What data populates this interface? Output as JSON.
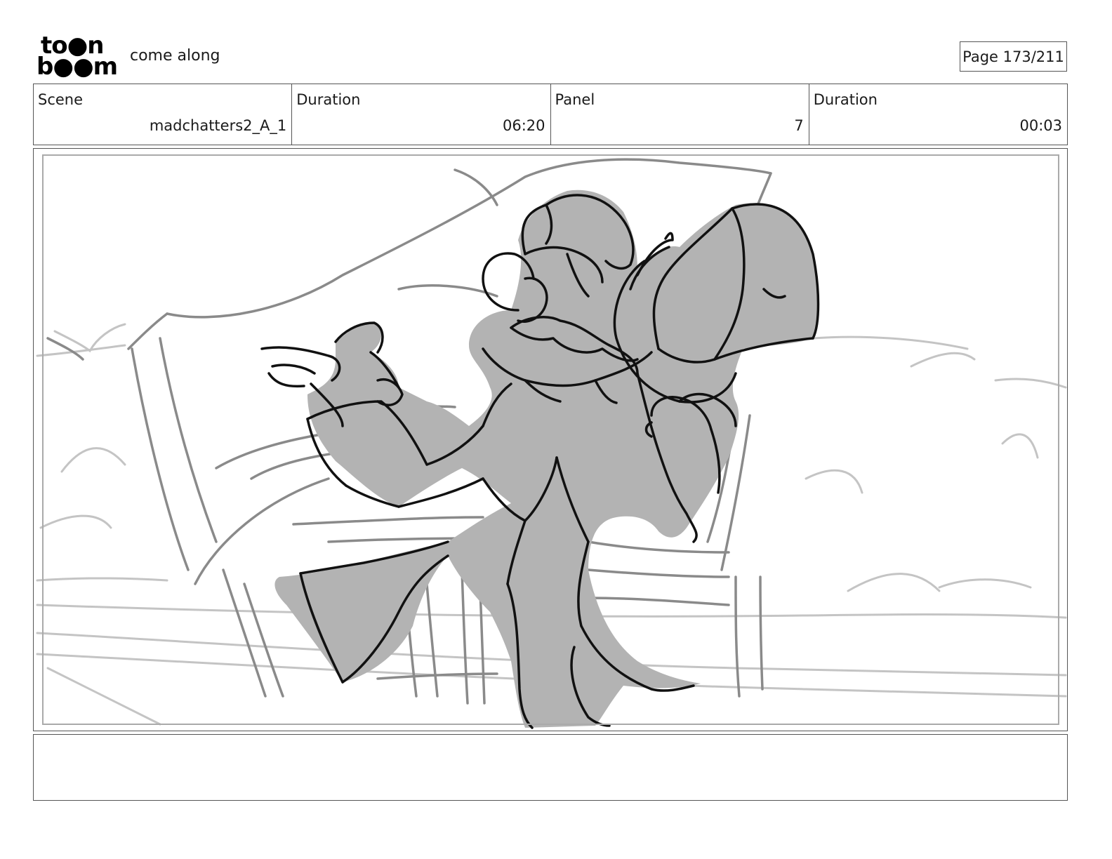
{
  "header": {
    "logo_line1": "to●n",
    "logo_line2": "b●●m",
    "project_title": "come along",
    "page_label": "Page 173/211"
  },
  "info": {
    "scene_label": "Scene",
    "scene_value": "madchatters2_A_1",
    "scene_duration_label": "Duration",
    "scene_duration_value": "06:20",
    "panel_label": "Panel",
    "panel_value": "7",
    "panel_duration_label": "Duration",
    "panel_duration_value": "00:03"
  },
  "notes": {
    "text": ""
  },
  "colors": {
    "figure_fill": "#b3b3b3",
    "outline": "#111111",
    "background_sketch": "#8a8a8a",
    "light_sketch": "#c4c4c4"
  }
}
